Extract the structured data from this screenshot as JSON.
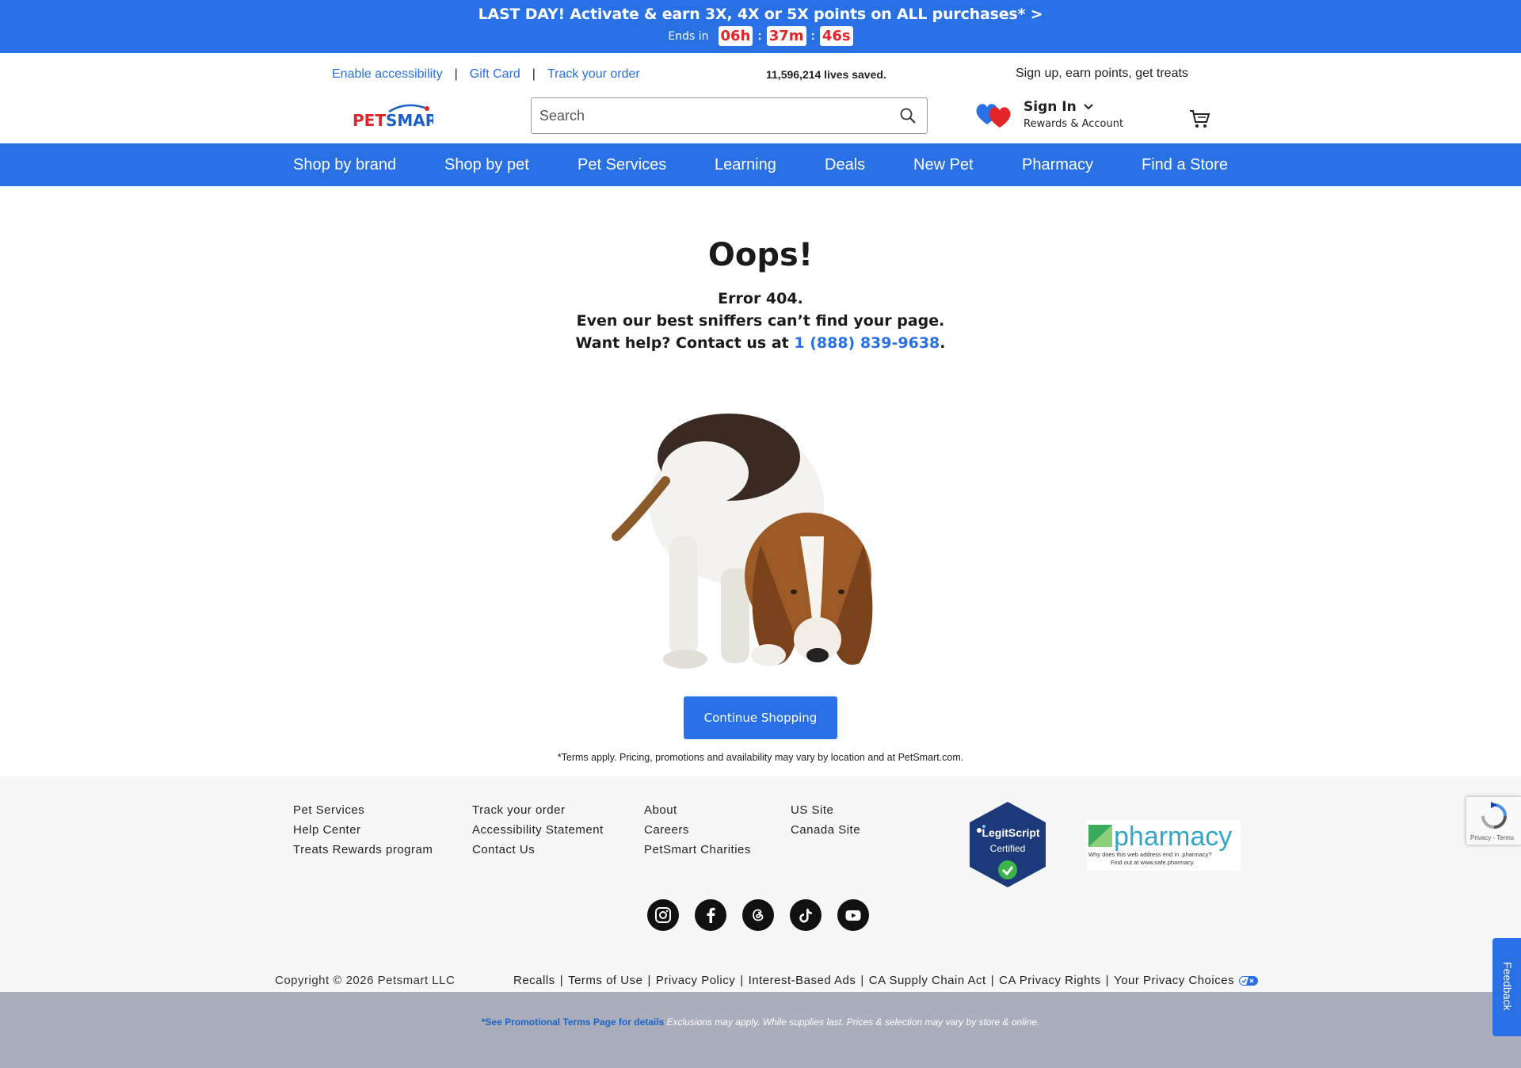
{
  "promo": {
    "headline": "LAST DAY! Activate & earn 3X, 4X or 5X points on ALL purchases* >",
    "ends_in": "Ends in",
    "hours": "06h",
    "minutes": "37m",
    "seconds": "46s",
    "separator": ":"
  },
  "utility": {
    "accessibility": "Enable accessibility",
    "gift_card": "Gift Card",
    "track_order": "Track your order",
    "pipe": "|",
    "lives_saved": "11,596,214 lives saved.",
    "signup": "Sign up, earn points, get treats"
  },
  "header": {
    "logo_text": "PETSMART",
    "search_placeholder": "Search",
    "sign_in": "Sign In",
    "rewards": "Rewards & Account"
  },
  "nav": {
    "items": [
      "Shop by brand",
      "Shop by pet",
      "Pet Services",
      "Learning",
      "Deals",
      "New Pet",
      "Pharmacy",
      "Find a Store"
    ]
  },
  "main": {
    "title": "Oops!",
    "line1": "Error 404.",
    "line2": "Even our best sniffers can’t find your page.",
    "line3_prefix": "Want help? Contact us at ",
    "phone": "1 (888) 839-9638",
    "line3_suffix": ".",
    "cta": "Continue Shopping",
    "terms": "*Terms apply. Pricing, promotions and availability may vary by location and at PetSmart.com."
  },
  "footer": {
    "col1": [
      "Pet Services",
      "Help Center",
      "Treats Rewards program"
    ],
    "col2": [
      "Track your order",
      "Accessibility Statement",
      "Contact Us"
    ],
    "col3": [
      "About",
      "Careers",
      "PetSmart Charities"
    ],
    "col4": [
      "US Site",
      "Canada Site"
    ],
    "legitscript_line1": "LegitScript",
    "legitscript_line2": "Certified",
    "pharmacy_word": "pharmacy",
    "pharmacy_line1": "Why does this web address end in .pharmacy?",
    "pharmacy_line2": "Find out at www.safe.pharmacy.",
    "social": [
      "instagram-icon",
      "facebook-icon",
      "threads-icon",
      "tiktok-icon",
      "youtube-icon"
    ],
    "copyright": "Copyright © 2026 Petsmart LLC",
    "legal": [
      "Recalls",
      "Terms of Use",
      "Privacy Policy",
      "Interest-Based Ads",
      "CA Supply Chain Act",
      "CA Privacy Rights",
      "Your Privacy Choices"
    ],
    "legal_sep": "|"
  },
  "promo_terms": {
    "link": "*See Promotional Terms Page for details",
    "text": " Exclusions may apply. While supplies last. Prices & selection may vary by store & online."
  },
  "widgets": {
    "recaptcha": "Privacy - Terms",
    "feedback": "Feedback"
  },
  "colors": {
    "brand_blue": "#2870e4",
    "timer_red": "#e4242b",
    "footer_bg": "#f6f6f6",
    "promo_terms_bg": "#aaadbb"
  }
}
